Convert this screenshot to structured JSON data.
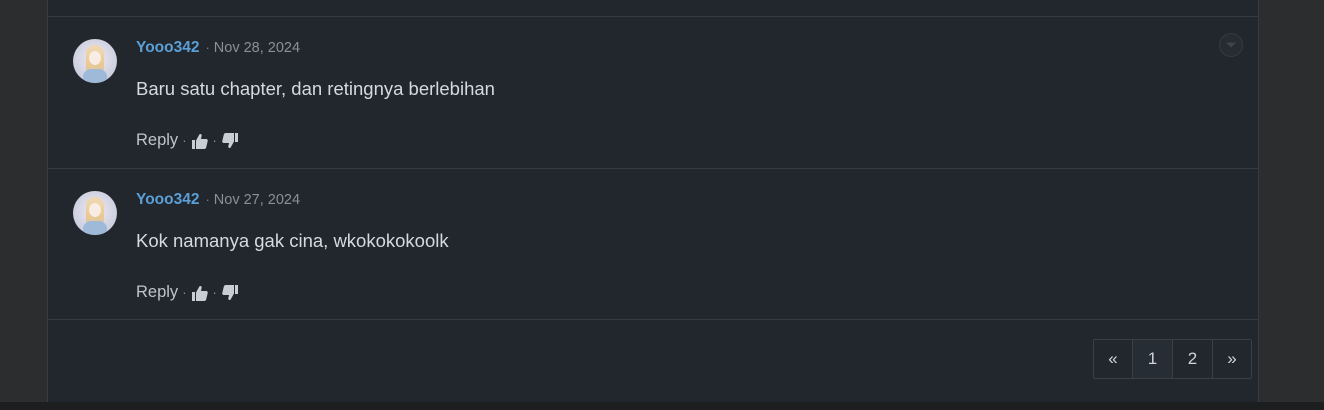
{
  "comments": [
    {
      "username": "Yooo342",
      "separator": "·",
      "date": "Nov 28, 2024",
      "text": "Baru satu chapter, dan retingnya berlebihan",
      "reply_label": "Reply",
      "has_menu": true
    },
    {
      "username": "Yooo342",
      "separator": "·",
      "date": "Nov 27, 2024",
      "text": "Kok namanya gak cina, wkokokokoolk",
      "reply_label": "Reply",
      "has_menu": false
    }
  ],
  "action_separator": "·",
  "pagination": {
    "prev": "«",
    "pages": [
      "1",
      "2"
    ],
    "next": "»",
    "active_page": "1"
  },
  "icons": {
    "like": "thumbs-up-icon",
    "dislike": "thumbs-down-icon",
    "menu": "chevron-down-icon"
  },
  "colors": {
    "background": "#2b2d2f",
    "panel": "#22272e",
    "username": "#5a9fd6",
    "text": "#d6d9dd"
  }
}
